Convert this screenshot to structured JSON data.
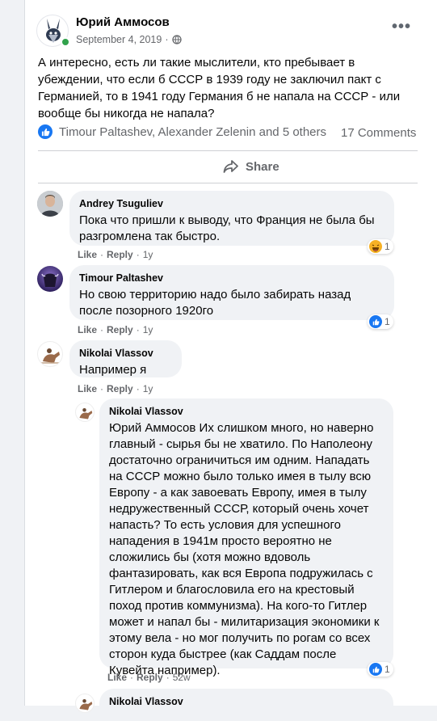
{
  "post": {
    "author": "Юрий Аммосов",
    "date": "September 4, 2019",
    "date_separator": "·",
    "privacy_icon": "globe-icon",
    "more_icon": "more-icon",
    "text": "А интересно, есть ли такие мыслители, кто пребывает в убеждении, что если б СССР в 1939 году не заключил пакт с Германией, то в 1941 году Германия б не напала на СССР - или вообще бы никогда не напала?",
    "reactions_names": "Timour Paltashev, Alexander Zelenin and 5 others",
    "comments_count": "17 Comments",
    "share_label": "Share"
  },
  "comments": [
    {
      "author": "Andrey Tsuguliev",
      "text": "Пока что пришли к выводу, что Франция не была бы разгромлена так быстро.",
      "like": "Like",
      "reply": "Reply",
      "sep": "·",
      "age": "1y",
      "reaction_type": "haha",
      "reaction_count": "1"
    },
    {
      "author": "Timour Paltashev",
      "text": "Но свою территорию надо было забирать назад после позорного 1920го",
      "like": "Like",
      "reply": "Reply",
      "sep": "·",
      "age": "1y",
      "reaction_type": "like",
      "reaction_count": "1"
    },
    {
      "author": "Nikolai Vlassov",
      "text": "Например я",
      "like": "Like",
      "reply": "Reply",
      "sep": "·",
      "age": "1y"
    }
  ],
  "replies": [
    {
      "author": "Nikolai Vlassov",
      "mention": "Юрий Аммосов",
      "text": "Их слишком много, но наверно главный - сырья бы не хватило. По Наполеону достаточно ограничиться им одним. Нападать на СССР можно было только имея в тылу всю Европу - а как завоевать Европу, имея в тылу недружественный СССР, который очень хочет напасть? То есть условия для успешного нападения в 1941м просто вероятно не сложились бы (хотя можно вдоволь фантазировать, как вся Европа подружилась с Гитлером и благословила его на крестовый поход против коммунизма). На кого-то Гитлер может и напал бы - милитаризация экономики к этому вела - но мог получить по рогам со всех сторон куда быстрее (как Саддам после Кувейта например).",
      "like": "Like",
      "reply": "Reply",
      "sep": "·",
      "age": "52w",
      "reaction_type": "like",
      "reaction_count": "1"
    },
    {
      "author": "Nikolai Vlassov"
    }
  ],
  "colors": {
    "accent": "#1877f2",
    "bubble": "#f0f2f5",
    "secondary_text": "#65676b"
  }
}
